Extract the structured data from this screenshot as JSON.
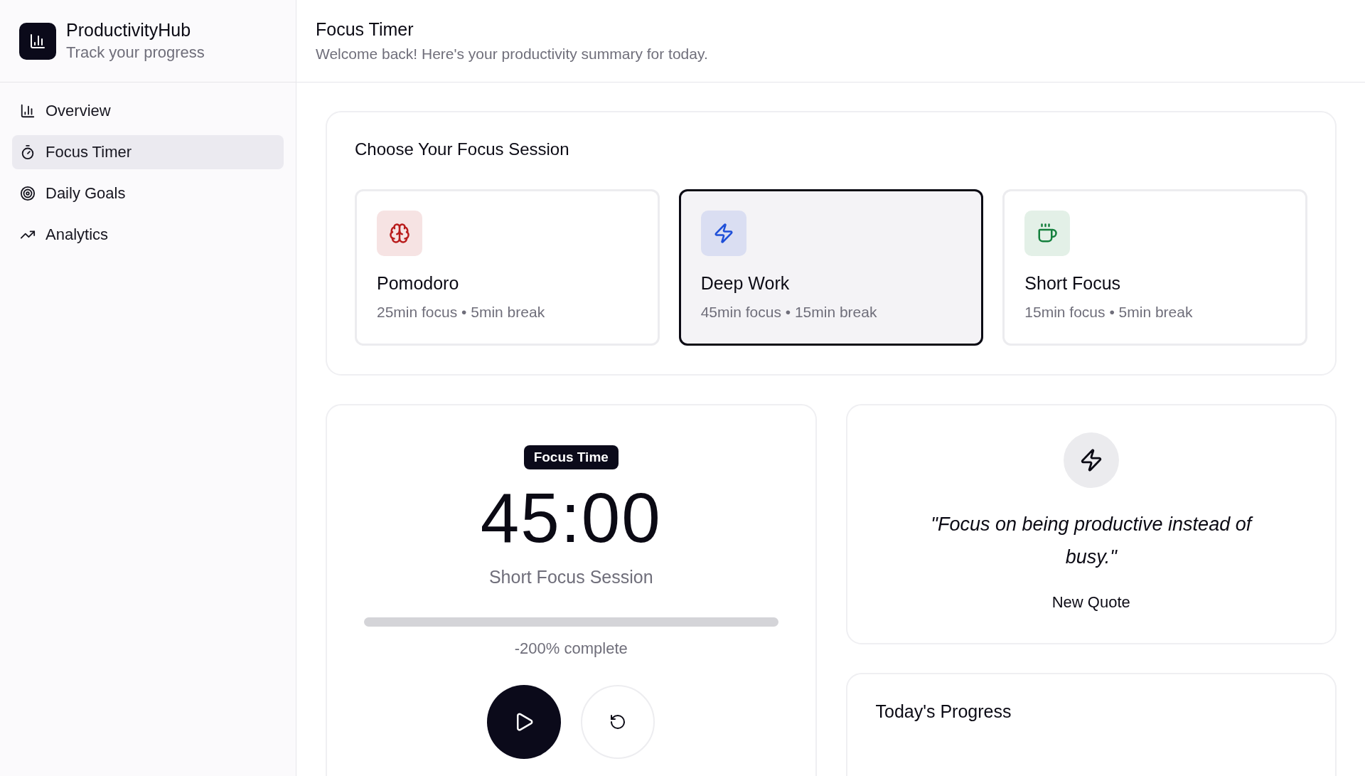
{
  "brand": {
    "name": "ProductivityHub",
    "tagline": "Track your progress"
  },
  "sidebar": {
    "items": [
      {
        "label": "Overview",
        "selected": false
      },
      {
        "label": "Focus Timer",
        "selected": true
      },
      {
        "label": "Daily Goals",
        "selected": false
      },
      {
        "label": "Analytics",
        "selected": false
      }
    ]
  },
  "header": {
    "title": "Focus Timer",
    "subtitle": "Welcome back! Here's your productivity summary for today."
  },
  "sessions": {
    "title": "Choose Your Focus Session",
    "items": [
      {
        "name": "Pomodoro",
        "detail": "25min focus • 5min break",
        "color": "#b91c1c",
        "selected": false
      },
      {
        "name": "Deep Work",
        "detail": "45min focus • 15min break",
        "color": "#1d4ed8",
        "selected": true
      },
      {
        "name": "Short Focus",
        "detail": "15min focus • 5min break",
        "color": "#15803d",
        "selected": false
      }
    ]
  },
  "timer": {
    "badge": "Focus Time",
    "time": "45:00",
    "session": "Short Focus Session",
    "level": 0,
    "progress_text": "-200% complete"
  },
  "quote": {
    "text": "\"Focus on being productive instead of busy.\"",
    "button": "New Quote"
  },
  "progress": {
    "title": "Today's Progress"
  }
}
